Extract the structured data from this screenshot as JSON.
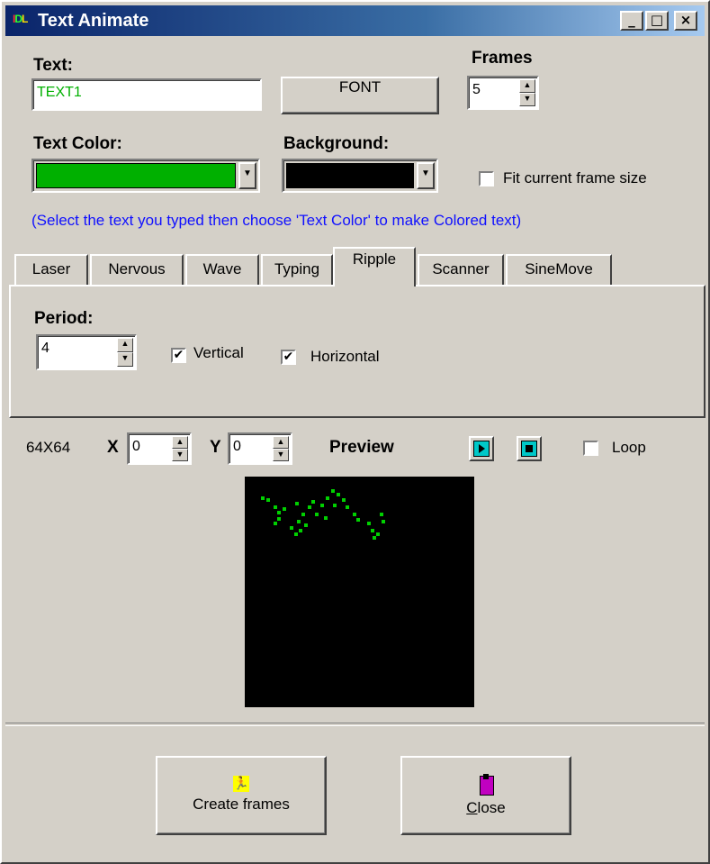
{
  "window": {
    "title": "Text Animate",
    "logo": "IDL"
  },
  "titlebar_buttons": {
    "minimize": "_",
    "maximize": "□",
    "close": "×"
  },
  "text": {
    "label": "Text:",
    "value": "TEXT1"
  },
  "font_button": "FONT",
  "frames": {
    "label": "Frames",
    "value": "5"
  },
  "text_color": {
    "label": "Text Color:",
    "color": "#00b000"
  },
  "background": {
    "label": "Background:",
    "color": "#000000"
  },
  "fit_frame": {
    "label": "Fit current frame size",
    "checked": false
  },
  "hint": "(Select the text you typed then choose 'Text Color' to make Colored text)",
  "tabs": [
    "Laser",
    "Nervous",
    "Wave",
    "Typing",
    "Ripple",
    "Scanner",
    "SineMove"
  ],
  "active_tab": "Ripple",
  "ripple": {
    "period_label": "Period:",
    "period_value": "4",
    "vertical_label": "Vertical",
    "horizontal_label": "Horizontal",
    "vertical_checked": true,
    "horizontal_checked": true
  },
  "preview": {
    "size": "64X64",
    "x_label": "X",
    "x_value": "0",
    "y_label": "Y",
    "y_value": "0",
    "title": "Preview",
    "loop_label": "Loop",
    "loop_checked": false
  },
  "buttons": {
    "create": "Create frames",
    "close": "Close"
  }
}
